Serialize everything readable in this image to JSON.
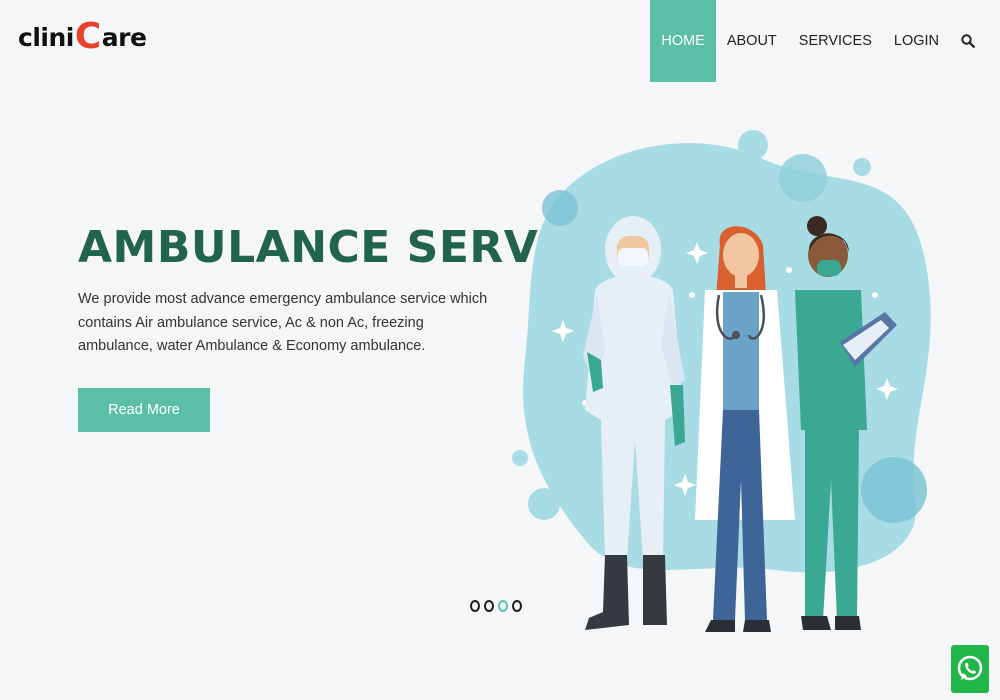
{
  "brand": {
    "prefix": "clini",
    "c": "C",
    "suffix": "are"
  },
  "nav": {
    "home": "HOME",
    "about": "ABOUT",
    "services": "SERVICES",
    "login": "LOGIN"
  },
  "hero": {
    "title": "AMBULANCE SERVICE",
    "description": "We provide most advance emergency ambulance service which contains Air ambulance service, Ac & non Ac, freezing ambulance, water Ambulance & Economy ambulance.",
    "button": "Read More"
  },
  "slider": {
    "count": 4,
    "active_index": 3
  },
  "colors": {
    "accent": "#5bbfa5",
    "title": "#22634f",
    "brand_c": "#e8412c",
    "whatsapp": "#21b64a"
  },
  "icons": {
    "search": "search-icon",
    "whatsapp": "whatsapp-icon"
  }
}
